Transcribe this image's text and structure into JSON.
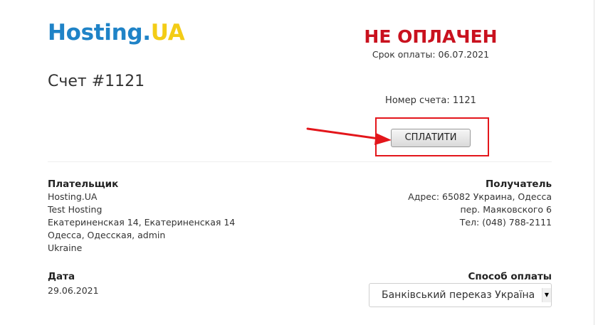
{
  "logo": {
    "part1": "Hosting.",
    "part2": "UA"
  },
  "status": {
    "text": "НЕ ОПЛАЧЕН",
    "due_label": "Срок оплаты: 06.07.2021",
    "color": "#c9111e"
  },
  "invoice": {
    "title": "Счет #1121",
    "number_label": "Номер счета: 1121"
  },
  "pay_button": {
    "label": "СПЛАТИТИ"
  },
  "payer": {
    "title": "Плательщик",
    "lines": [
      "Hosting.UA",
      "Test Hosting",
      "Екатериненская 14, Екатериненская 14",
      "Одесса, Одесская, admin",
      "Ukraine"
    ]
  },
  "recipient": {
    "title": "Получатель",
    "lines": [
      "Адрес: 65082 Украина, Одесса",
      "пер. Маяковского 6",
      "Тел: (048) 788-2111"
    ]
  },
  "date": {
    "title": "Дата",
    "value": "29.06.2021"
  },
  "payment_method": {
    "title": "Способ оплаты",
    "selected": "Банківський переказ Україна"
  },
  "colors": {
    "logo_blue": "#1f83c7",
    "logo_yellow": "#f3cc16",
    "annotation_red": "#e3161b"
  }
}
